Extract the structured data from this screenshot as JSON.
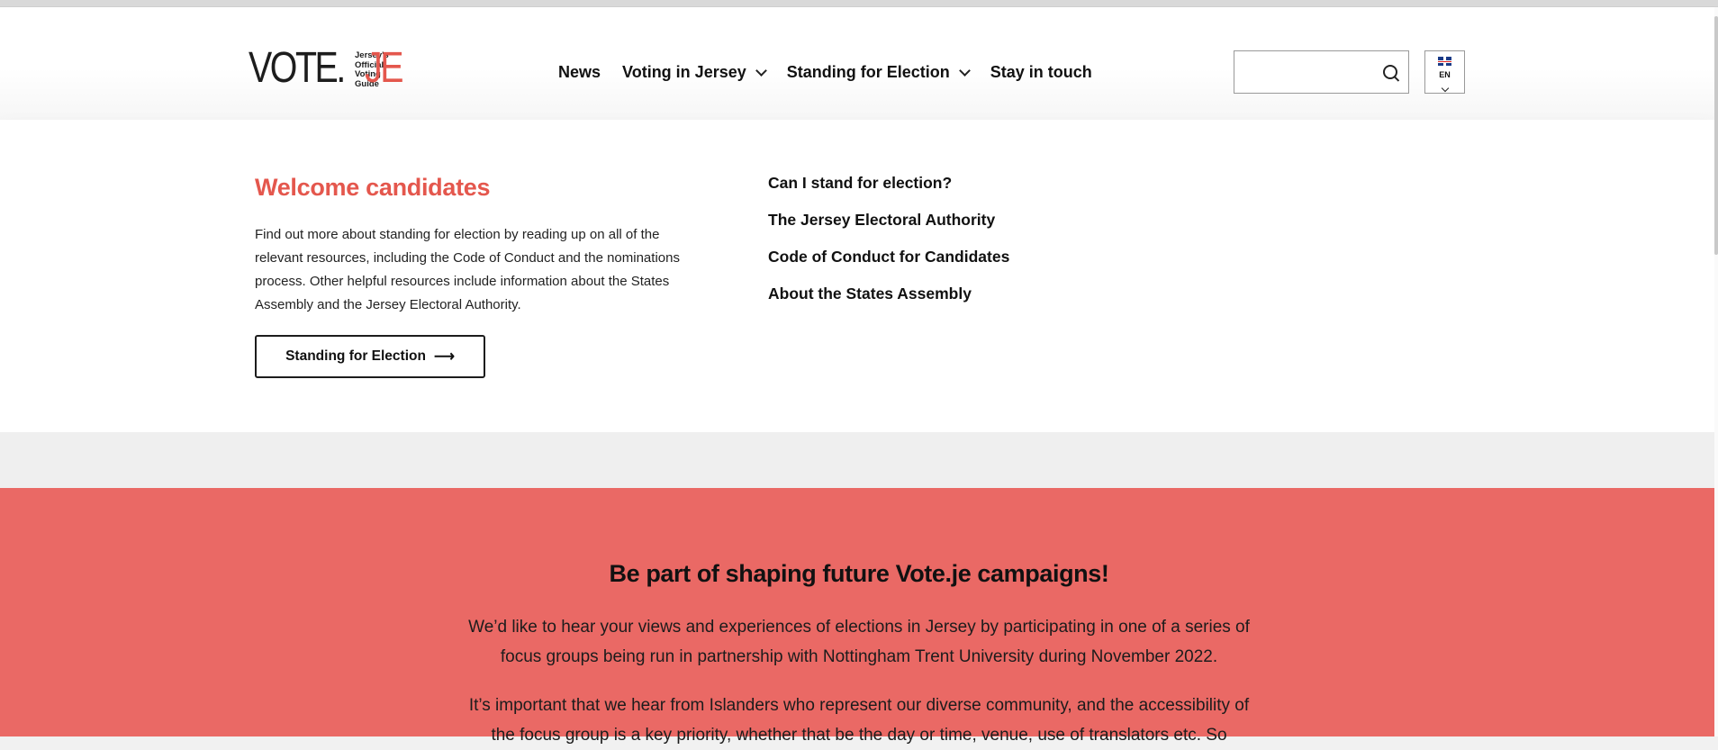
{
  "logo": {
    "word_vote": "VOTE.",
    "word_je": "JE",
    "tagline": "Jersey's Official Voting Guide"
  },
  "nav": {
    "items": [
      {
        "label": "News",
        "has_dropdown": false
      },
      {
        "label": "Voting in Jersey",
        "has_dropdown": true
      },
      {
        "label": "Standing for Election",
        "has_dropdown": true
      },
      {
        "label": "Stay in touch",
        "has_dropdown": false
      }
    ]
  },
  "search": {
    "value": "",
    "placeholder": "",
    "icon": "search-icon"
  },
  "language": {
    "code": "EN",
    "icon": "uk-flag-icon"
  },
  "dropdown": {
    "title": "Welcome candidates",
    "text": "Find out more about standing for election by reading up on all of the relevant resources, including the Code of Conduct and the nominations process. Other helpful resources include information about the States Assembly and the Jersey Electoral Authority.",
    "button_label": "Standing for Election",
    "button_arrow": "⟶",
    "links": [
      "Can I stand for election?",
      "The Jersey Electoral Authority",
      "Code of Conduct for Candidates",
      "About the States Assembly"
    ]
  },
  "promo": {
    "title": "Be part of shaping future Vote.je campaigns!",
    "paragraph1": "We’d like to hear your views and experiences of elections in Jersey by participating in one of a series of focus groups being run in partnership with Nottingham Trent University during November 2022.",
    "paragraph2": "It’s important that we hear from Islanders who represent our diverse community, and the accessibility of the focus group is a key priority, whether that be the day or time, venue, use of translators etc. So"
  },
  "colors": {
    "accent": "#e4574d",
    "promo_background": "#ea6965",
    "text": "#111111"
  }
}
